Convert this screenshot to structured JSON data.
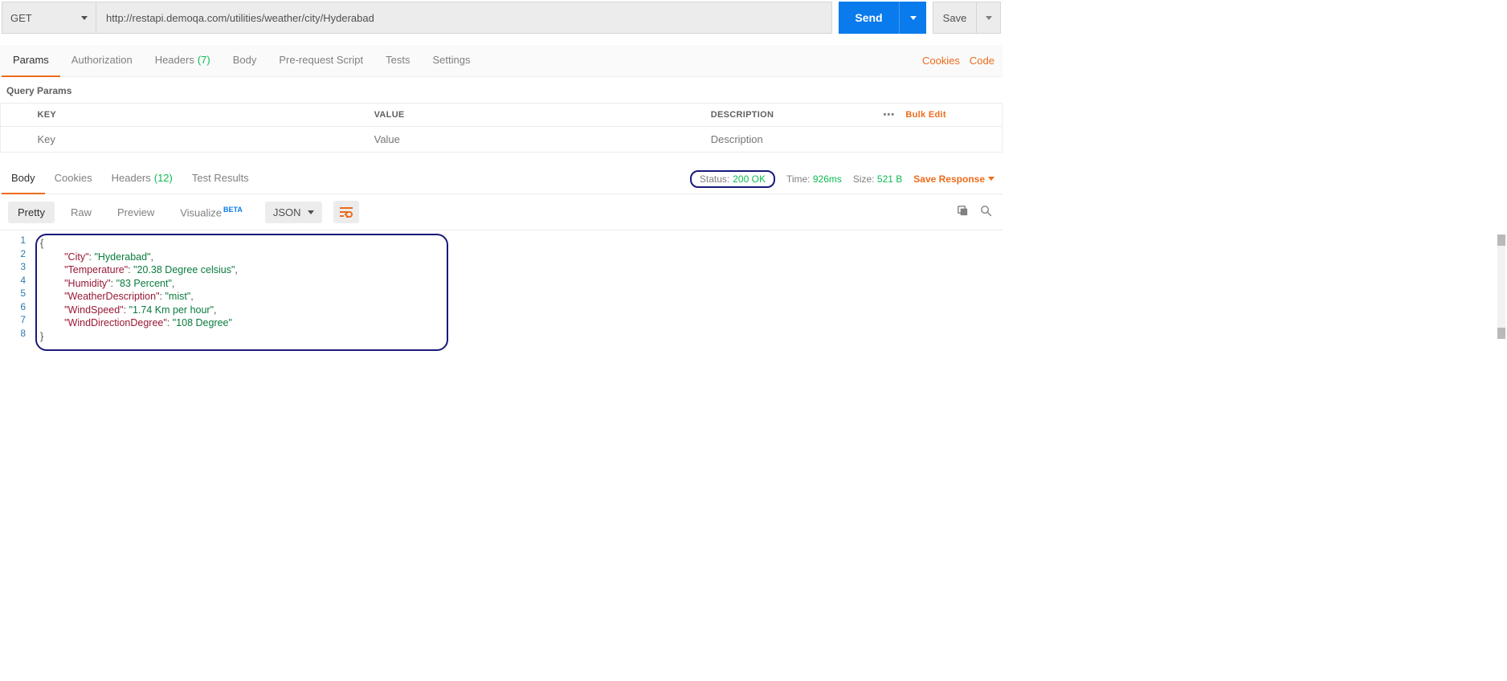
{
  "request": {
    "method": "GET",
    "url": "http://restapi.demoqa.com/utilities/weather/city/Hyderabad",
    "send_label": "Send",
    "save_label": "Save"
  },
  "request_tabs": {
    "params": "Params",
    "authorization": "Authorization",
    "headers": "Headers",
    "headers_count": "(7)",
    "body": "Body",
    "prerequest": "Pre-request Script",
    "tests": "Tests",
    "settings": "Settings",
    "cookies_link": "Cookies",
    "code_link": "Code"
  },
  "query_params": {
    "title": "Query Params",
    "key_header": "KEY",
    "value_header": "VALUE",
    "desc_header": "DESCRIPTION",
    "bulk_edit": "Bulk Edit",
    "key_placeholder": "Key",
    "value_placeholder": "Value",
    "desc_placeholder": "Description"
  },
  "response_tabs": {
    "body": "Body",
    "cookies": "Cookies",
    "headers": "Headers",
    "headers_count": "(12)",
    "test_results": "Test Results"
  },
  "response_meta": {
    "status_label": "Status:",
    "status_value": "200 OK",
    "time_label": "Time:",
    "time_value": "926ms",
    "size_label": "Size:",
    "size_value": "521 B",
    "save_response": "Save Response"
  },
  "view_tabs": {
    "pretty": "Pretty",
    "raw": "Raw",
    "preview": "Preview",
    "visualize": "Visualize",
    "beta": "BETA",
    "format": "JSON"
  },
  "response_body": {
    "lines": [
      1,
      2,
      3,
      4,
      5,
      6,
      7,
      8
    ],
    "json": {
      "City": "Hyderabad",
      "Temperature": "20.38 Degree celsius",
      "Humidity": "83 Percent",
      "WeatherDescription": "mist",
      "WindSpeed": "1.74 Km per hour",
      "WindDirectionDegree": "108 Degree"
    }
  }
}
